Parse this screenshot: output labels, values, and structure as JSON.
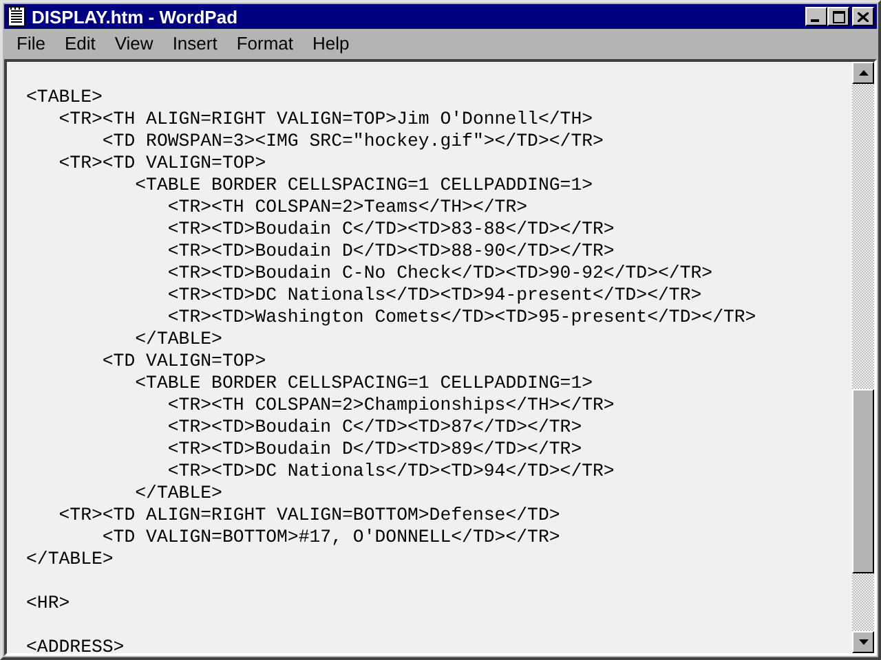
{
  "window": {
    "title": "DISPLAY.htm - WordPad"
  },
  "menu": [
    {
      "label": "File"
    },
    {
      "label": "Edit"
    },
    {
      "label": "View"
    },
    {
      "label": "Insert"
    },
    {
      "label": "Format"
    },
    {
      "label": "Help"
    }
  ],
  "document": {
    "blocks": [
      {
        "lines": [
          "<TABLE>",
          "   <TR><TH ALIGN=RIGHT VALIGN=TOP>Jim O'Donnell</TH>",
          "       <TD ROWSPAN=3><IMG SRC=\"hockey.gif\"></TD></TR>",
          "   <TR><TD VALIGN=TOP>",
          "          <TABLE BORDER CELLSPACING=1 CELLPADDING=1>",
          "             <TR><TH COLSPAN=2>Teams</TH></TR>",
          "             <TR><TD>Boudain C</TD><TD>83-88</TD></TR>",
          "             <TR><TD>Boudain D</TD><TD>88-90</TD></TR>",
          "             <TR><TD>Boudain C-No Check</TD><TD>90-92</TD></TR>",
          "             <TR><TD>DC Nationals</TD><TD>94-present</TD></TR>",
          "             <TR><TD>Washington Comets</TD><TD>95-present</TD></TR>",
          "          </TABLE>",
          "       <TD VALIGN=TOP>",
          "          <TABLE BORDER CELLSPACING=1 CELLPADDING=1>",
          "             <TR><TH COLSPAN=2>Championships</TH></TR>",
          "             <TR><TD>Boudain C</TD><TD>87</TD></TR>",
          "             <TR><TD>Boudain D</TD><TD>89</TD></TR>",
          "             <TR><TD>DC Nationals</TD><TD>94</TD></TR>",
          "          </TABLE>",
          "   <TR><TD ALIGN=RIGHT VALIGN=BOTTOM>Defense</TD>",
          "       <TD VALIGN=BOTTOM>#17, O'DONNELL</TD></TR>",
          "</TABLE>"
        ]
      },
      {
        "lines": [
          "<HR>"
        ]
      },
      {
        "lines": [
          "<ADDRESS>"
        ]
      }
    ]
  }
}
